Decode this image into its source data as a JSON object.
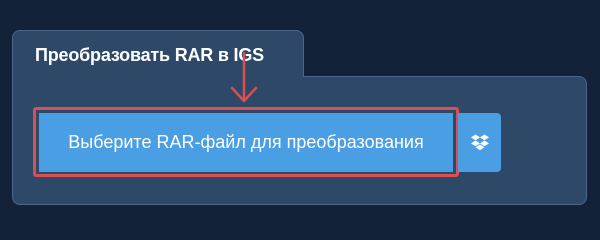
{
  "converter": {
    "title": "Преобразовать RAR в IGS",
    "upload_label": "Выберите RAR-файл для преобразования"
  },
  "icons": {
    "pointer": "arrow-down-icon",
    "dropbox": "dropbox-icon"
  },
  "colors": {
    "page_background": "#132238",
    "panel_background": "#2e4868",
    "button_blue": "#4a9ee3",
    "highlight_red": "#d8504f"
  }
}
